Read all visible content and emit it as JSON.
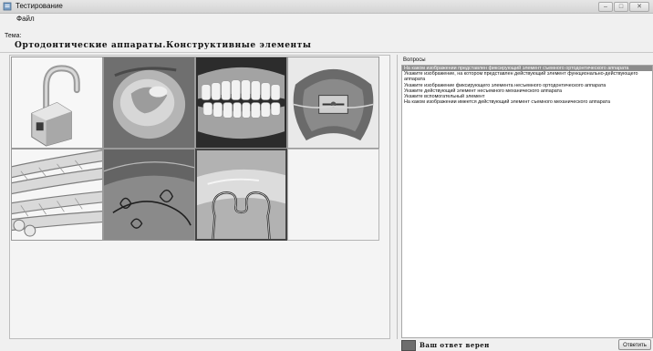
{
  "window": {
    "title": "Тестирование",
    "controls": {
      "minimize": "–",
      "maximize": "□",
      "close": "✕"
    }
  },
  "menu": {
    "file_label": "Файл"
  },
  "theme": {
    "label": "Тема:",
    "value": "Ортодонтические аппараты.Конструктивные элементы"
  },
  "images": [
    {
      "name": "padlock-element",
      "selected": false
    },
    {
      "name": "tooth-crown",
      "selected": false
    },
    {
      "name": "dentures",
      "selected": false
    },
    {
      "name": "palatal-plate-screw",
      "selected": false
    },
    {
      "name": "twisted-wire",
      "selected": false
    },
    {
      "name": "wire-loops",
      "selected": false
    },
    {
      "name": "omega-loop-spring",
      "selected": true
    },
    {
      "name": "empty",
      "selected": false
    }
  ],
  "questions": {
    "label": "Вопросы",
    "items": [
      "На каком изображении представлен фиксирующий элемент съемного ортодонтического аппарата",
      "Укажите изображение, на котором представлен действующий элемент функционально-действующего аппарата",
      "Укажите изображение фиксирующего элемента несъемного ортодонтического аппарата",
      "Укажите действующий элемент несъемного механического аппарата",
      "Укажите вспомогательный элемент",
      "На каком изображении имеется действующий элемент съемного механического аппарата"
    ],
    "selected_index": 0
  },
  "status": {
    "text": "Ваш ответ верен",
    "color": "#6e6e6e"
  },
  "answer_button": {
    "label": "Ответить"
  }
}
